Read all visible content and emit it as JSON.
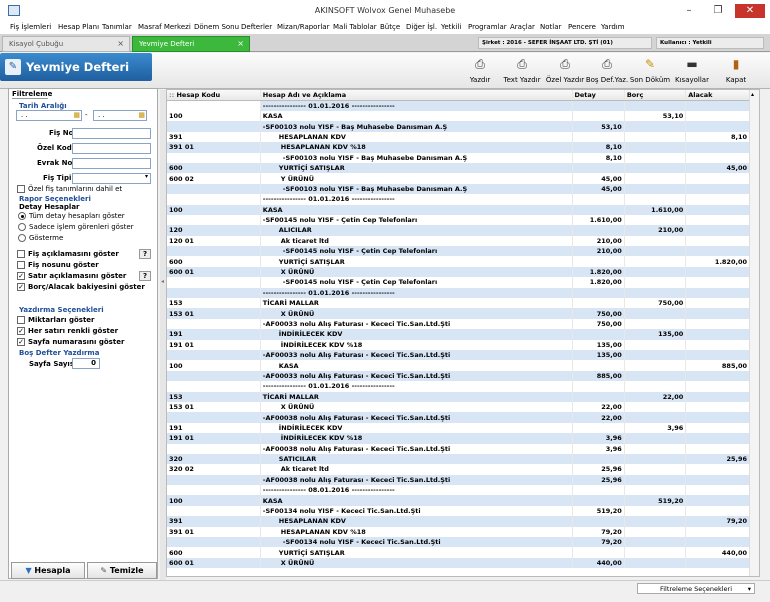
{
  "window": {
    "title": "AKINSOFT Wolvox Genel Muhasebe",
    "minimize": "–",
    "maximize": "❐",
    "close": "✕"
  },
  "menu": [
    "Fiş İşlemleri",
    "Hesap Planı",
    "Tanımlar",
    "Masraf Merkezi",
    "Dönem Sonu",
    "Defterler",
    "Mizan/Raporlar",
    "Mali Tablolar",
    "Bütçe",
    "Diğer İşl.",
    "Yetkili",
    "Programlar",
    "Araçlar",
    "Notlar",
    "Pencere",
    "Yardım"
  ],
  "tabs": [
    {
      "label": "Kisayol Çubuğu"
    },
    {
      "label": "Yevmiye Defteri"
    }
  ],
  "info": {
    "company": "Şirket : 2016 - SEFER İNŞAAT LTD. ŞTİ (01)",
    "user": "Kullanıcı : Yetkili"
  },
  "page_title": "Yevmiye Defteri",
  "toolbar": [
    "Yazdır",
    "Text Yazdır",
    "Özel Yazdır",
    "Boş Def.Yaz.",
    "Son Döküm",
    "Kısayollar",
    "Kapat"
  ],
  "filter": {
    "tab": "Filtreleme",
    "date_range_label": "Tarih Aralığı",
    "date_from": ". .",
    "date_sep": "-",
    "date_to": ". .",
    "fis_no": "Fiş No",
    "ozel_kodu": "Özel Kodu",
    "evrak_no": "Evrak No",
    "fis_tipi": "Fiş Tipi",
    "ozel_fis": "Özel fiş tanımlarını dahil et",
    "rapor_sec": "Rapor Seçenekleri",
    "detay_hesaplar": "Detay Hesaplar",
    "radio": [
      "Tüm detay hesapları göster",
      "Sadece işlem görenleri göster",
      "Gösterme"
    ],
    "checks": [
      "Fiş açıklamasını göster",
      "Fiş nosunu göster",
      "Satır açıklamasını göster",
      "Borç/Alacak bakiyesini göster"
    ],
    "yazdirma": "Yazdırma Seçenekleri",
    "print_checks": [
      "Miktarları göster",
      "Her satırı renkli göster",
      "Sayfa numarasını göster"
    ],
    "bos_defter": "Boş Defter Yazdırma",
    "sayfa_sayisi": "Sayfa Sayısı",
    "sayfa_val": "0",
    "hesapla": "Hesapla",
    "temizle": "Temizle",
    "help": "?"
  },
  "grid": {
    "columns": [
      "Hesap Kodu",
      "Hesap Adı ve Açıklama",
      "Detay",
      "Borç",
      "Alacak"
    ],
    "rows": [
      [
        "",
        "---------------- 01.01.2016 ----------------",
        "",
        "",
        ""
      ],
      [
        "100",
        "KASA",
        "",
        "53,10",
        ""
      ],
      [
        "",
        "-SF00103 nolu YISF - Baş Muhasebe Danısman A.Ş",
        "53,10",
        "",
        ""
      ],
      [
        "391",
        "HESAPLANAN KDV",
        "",
        "",
        "8,10"
      ],
      [
        "391 01",
        "HESAPLANAN KDV %18",
        "8,10",
        "",
        ""
      ],
      [
        "",
        "-SF00103 nolu YISF - Baş Muhasebe Danısman A.Ş",
        "8,10",
        "",
        ""
      ],
      [
        "600",
        "YURTİÇİ SATIŞLAR",
        "",
        "",
        "45,00"
      ],
      [
        "600 02",
        "Y ÜRÜNÜ",
        "45,00",
        "",
        ""
      ],
      [
        "",
        "-SF00103 nolu YISF - Baş Muhasebe Danısman A.Ş",
        "45,00",
        "",
        ""
      ],
      [
        "",
        "---------------- 01.01.2016 ----------------",
        "",
        "",
        ""
      ],
      [
        "100",
        "KASA",
        "",
        "1.610,00",
        ""
      ],
      [
        "",
        "-SF00145 nolu YISF - Çetin Cep Telefonları",
        "1.610,00",
        "",
        ""
      ],
      [
        "120",
        "ALICILAR",
        "",
        "210,00",
        ""
      ],
      [
        "120 01",
        "Ak ticaret ltd",
        "210,00",
        "",
        ""
      ],
      [
        "",
        "-SF00145 nolu YISF - Çetin Cep Telefonları",
        "210,00",
        "",
        ""
      ],
      [
        "600",
        "YURTİÇİ SATIŞLAR",
        "",
        "",
        "1.820,00"
      ],
      [
        "600 01",
        "X ÜRÜNÜ",
        "1.820,00",
        "",
        ""
      ],
      [
        "",
        "-SF00145 nolu YISF - Çetin Cep Telefonları",
        "1.820,00",
        "",
        ""
      ],
      [
        "",
        "---------------- 01.01.2016 ----------------",
        "",
        "",
        ""
      ],
      [
        "153",
        "TİCARİ MALLAR",
        "",
        "750,00",
        ""
      ],
      [
        "153 01",
        "X ÜRÜNÜ",
        "750,00",
        "",
        ""
      ],
      [
        "",
        "-AF00033 nolu Alış Faturası - Kececi Tic.San.Ltd.Şti",
        "750,00",
        "",
        ""
      ],
      [
        "191",
        "İNDİRİLECEK KDV",
        "",
        "135,00",
        ""
      ],
      [
        "191 01",
        "İNDİRİLECEK KDV %18",
        "135,00",
        "",
        ""
      ],
      [
        "",
        "-AF00033 nolu Alış Faturası - Kececi Tic.San.Ltd.Şti",
        "135,00",
        "",
        ""
      ],
      [
        "100",
        "KASA",
        "",
        "",
        "885,00"
      ],
      [
        "",
        "-AF00033 nolu Alış Faturası - Kececi Tic.San.Ltd.Şti",
        "885,00",
        "",
        ""
      ],
      [
        "",
        "---------------- 01.01.2016 ----------------",
        "",
        "",
        ""
      ],
      [
        "153",
        "TİCARİ MALLAR",
        "",
        "22,00",
        ""
      ],
      [
        "153 01",
        "X ÜRÜNÜ",
        "22,00",
        "",
        ""
      ],
      [
        "",
        "-AF00038 nolu Alış Faturası - Kececi Tic.San.Ltd.Şti",
        "22,00",
        "",
        ""
      ],
      [
        "191",
        "İNDİRİLECEK KDV",
        "",
        "3,96",
        ""
      ],
      [
        "191 01",
        "İNDİRİLECEK KDV %18",
        "3,96",
        "",
        ""
      ],
      [
        "",
        "-AF00038 nolu Alış Faturası - Kececi Tic.San.Ltd.Şti",
        "3,96",
        "",
        ""
      ],
      [
        "320",
        "SATICILAR",
        "",
        "",
        "25,96"
      ],
      [
        "320 02",
        "Ak ticaret ltd",
        "25,96",
        "",
        ""
      ],
      [
        "",
        "-AF00038 nolu Alış Faturası - Kececi Tic.San.Ltd.Şti",
        "25,96",
        "",
        ""
      ],
      [
        "",
        "---------------- 08.01.2016 ----------------",
        "",
        "",
        ""
      ],
      [
        "100",
        "KASA",
        "",
        "519,20",
        ""
      ],
      [
        "",
        "-SF00134 nolu YISF - Kececi Tic.San.Ltd.Şti",
        "519,20",
        "",
        ""
      ],
      [
        "391",
        "HESAPLANAN KDV",
        "",
        "",
        "79,20"
      ],
      [
        "391 01",
        "HESAPLANAN KDV %18",
        "79,20",
        "",
        ""
      ],
      [
        "",
        "-SF00134 nolu YISF - Kececi Tic.San.Ltd.Şti",
        "79,20",
        "",
        ""
      ],
      [
        "600",
        "YURTİÇİ SATIŞLAR",
        "",
        "",
        "440,00"
      ],
      [
        "600 01",
        "X ÜRÜNÜ",
        "440,00",
        "",
        ""
      ]
    ]
  },
  "status": {
    "filter_options": "Filtreleme Seçenekleri"
  }
}
